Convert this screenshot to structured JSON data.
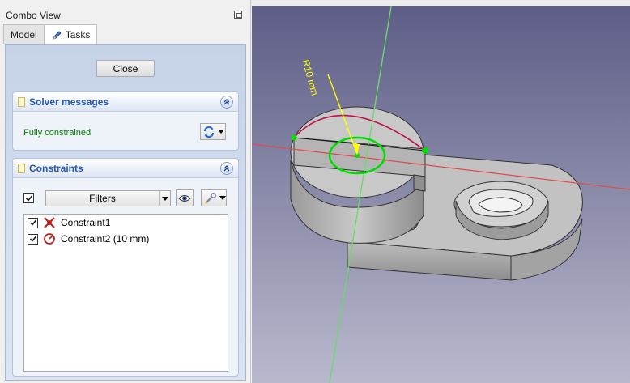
{
  "combo_view": {
    "title": "Combo View",
    "tabs": [
      {
        "label": "Model",
        "active": false
      },
      {
        "label": "Tasks",
        "active": true
      }
    ]
  },
  "task_panel": {
    "close_label": "Close",
    "solver_messages": {
      "title": "Solver messages",
      "status": "Fully constrained",
      "status_color": "#008000"
    },
    "constraints": {
      "title": "Constraints",
      "filter_label": "Filters",
      "items": [
        {
          "label": "Constraint1",
          "checked": true,
          "icon": "coincident-constraint-icon"
        },
        {
          "label": "Constraint2 (10 mm)",
          "checked": true,
          "icon": "radius-constraint-icon"
        }
      ]
    }
  },
  "viewport": {
    "dimension_label": "R10 mm",
    "background_top": "#5d5d87",
    "background_bottom": "#b9b9cd",
    "dimension_color": "#ffff00",
    "selection_color": "#00dd00",
    "axis_x_color": "#e24a4a",
    "axis_y_color": "#6cd96c"
  }
}
